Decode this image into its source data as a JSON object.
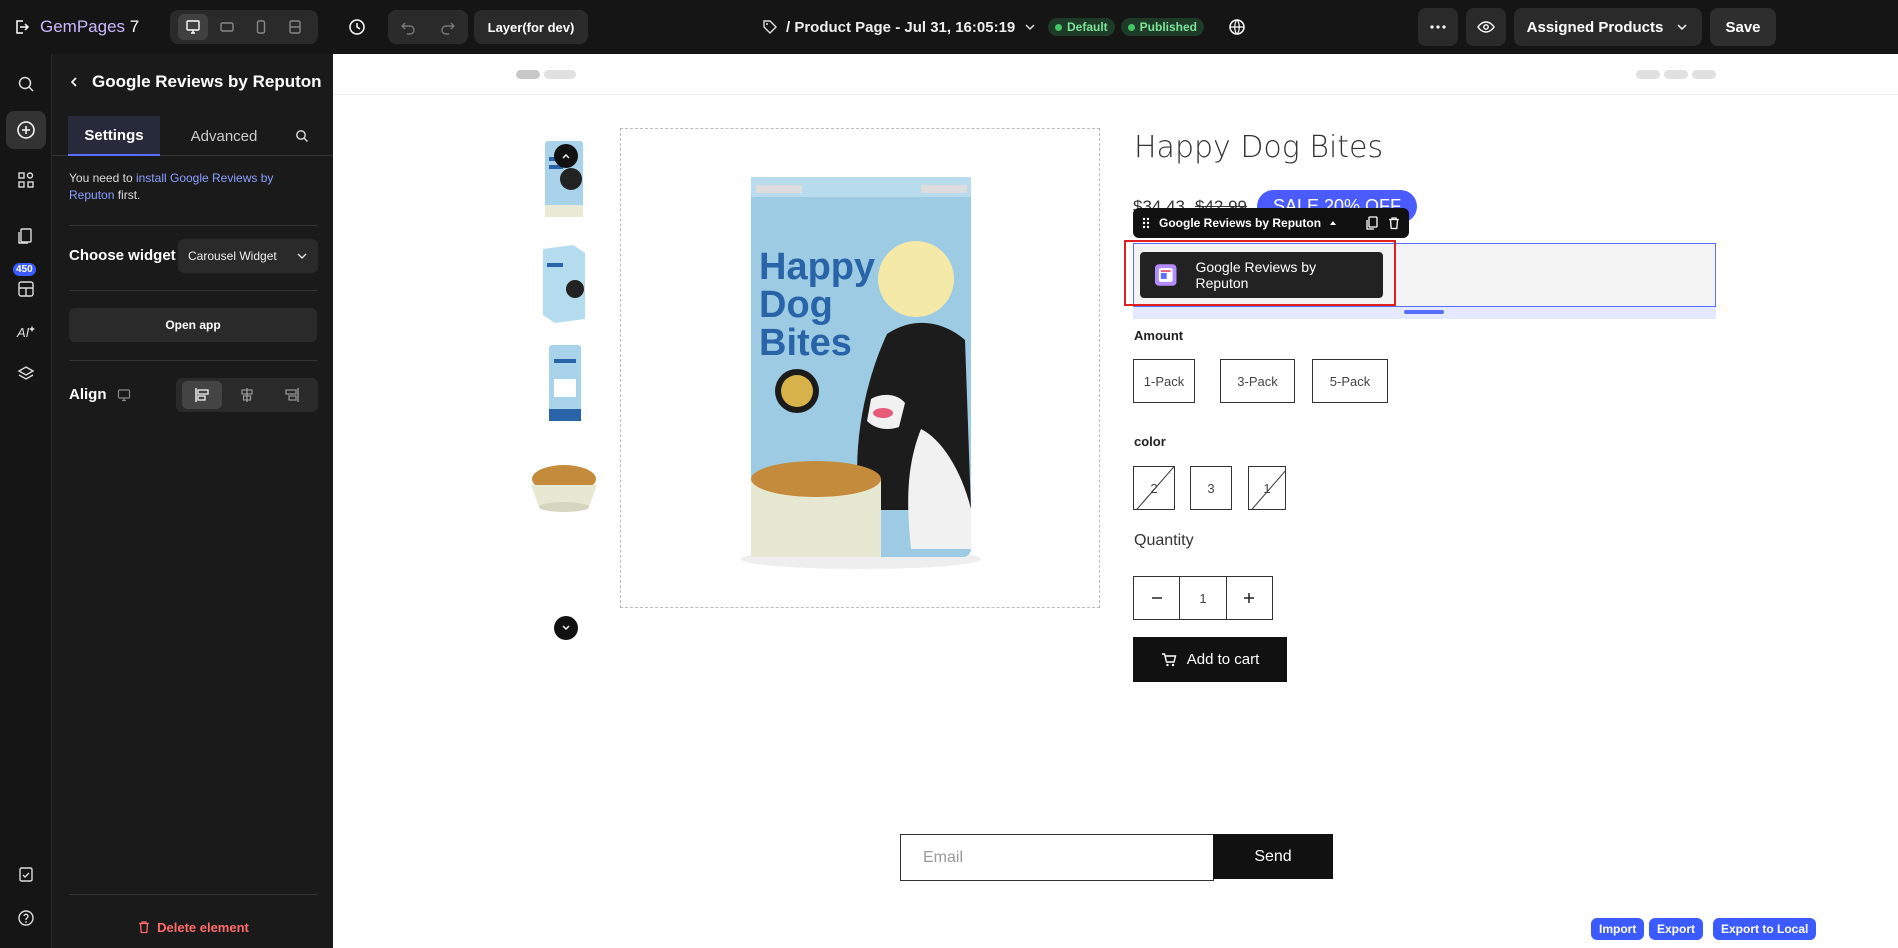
{
  "topbar": {
    "brand": "GemPages",
    "version": "7",
    "layer_label": "Layer(for dev)",
    "page_title": "/ Product Page - Jul 31, 16:05:19",
    "badge_default": "Default",
    "badge_published": "Published",
    "assigned_label": "Assigned Products",
    "save_label": "Save"
  },
  "rail": {
    "count": "450"
  },
  "panel": {
    "title": "Google Reviews by Reputon",
    "tabs": [
      "Settings",
      "Advanced"
    ],
    "notice_prefix": "You need to ",
    "notice_link": "install Google Reviews by Reputon",
    "notice_suffix": " first.",
    "choose_widget_label": "Choose widget",
    "widget_value": "Carousel Widget",
    "open_app_label": "Open app",
    "align_label": "Align",
    "delete_label": "Delete element"
  },
  "product": {
    "title": "Happy Dog Bites",
    "price": "$34.43",
    "compare_price": "$42.99",
    "sale_badge": "SALE 20% OFF",
    "app_toolbar_label": "Google Reviews by Reputon",
    "app_block_label": "Google Reviews by Reputon",
    "amount_label": "Amount",
    "amount_options": [
      "1-Pack",
      "3-Pack",
      "5-Pack"
    ],
    "color_label": "color",
    "color_options": [
      "2",
      "3",
      "1"
    ],
    "quantity_label": "Quantity",
    "quantity_value": "1",
    "add_to_cart": "Add to cart",
    "package_text": "Happy Dog Bites"
  },
  "newsletter": {
    "email_placeholder": "Email",
    "send_label": "Send"
  },
  "footer_actions": {
    "import": "Import",
    "export": "Export",
    "export_local": "Export to Local"
  },
  "colors": {
    "accent": "#4a5bff",
    "published": "#43c66a",
    "danger": "#ff6b6b",
    "package_blue": "#9ccbe3"
  }
}
